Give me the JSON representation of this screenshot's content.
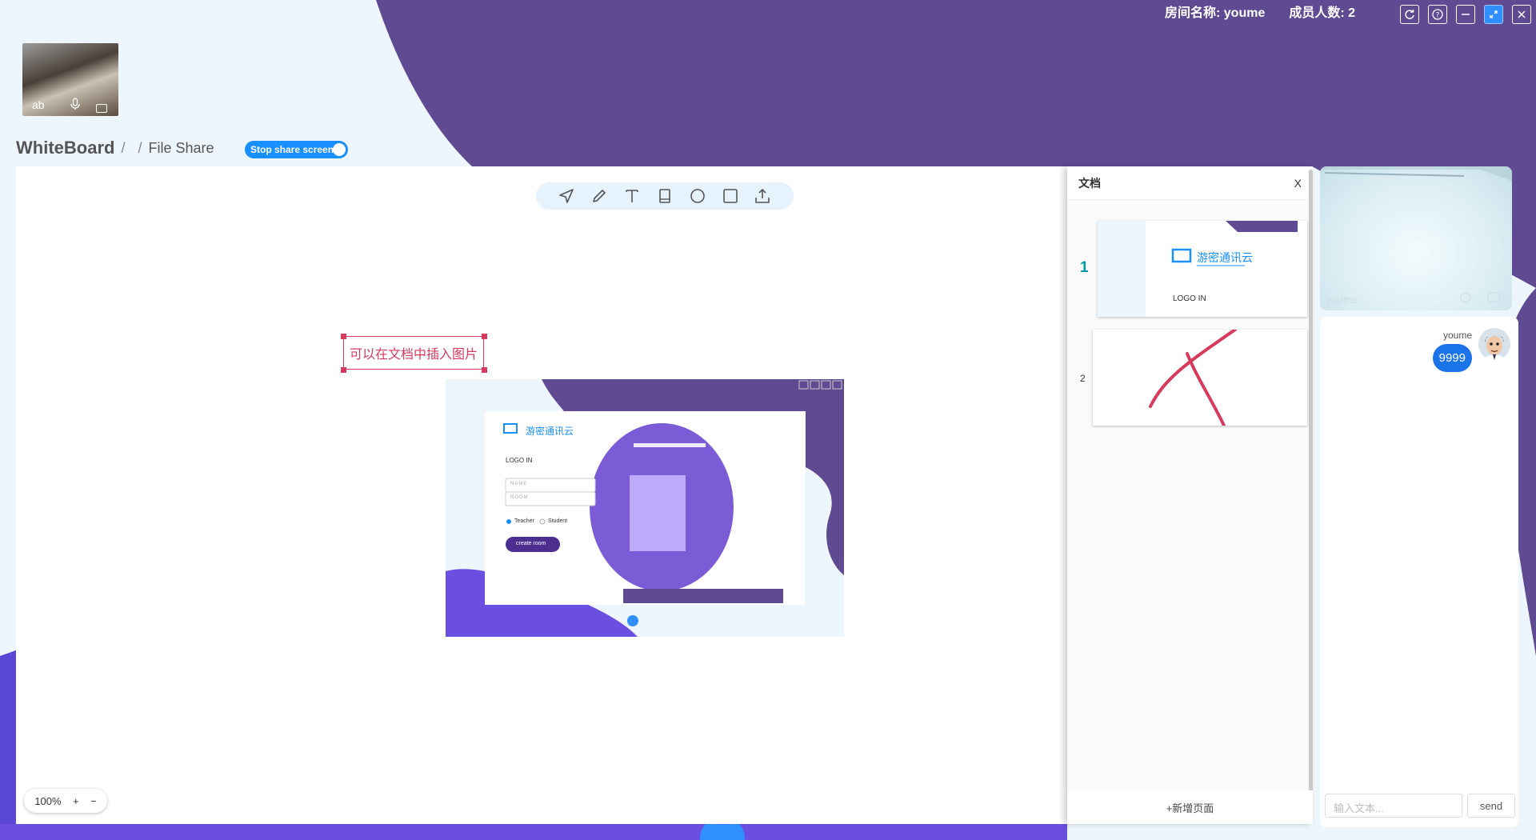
{
  "header": {
    "room_name": "房间名称: youme",
    "member_count": "成员人数: 2",
    "controls": [
      "refresh-icon",
      "help-icon",
      "minimize-icon",
      "restore-icon",
      "close-icon"
    ]
  },
  "self_video": {
    "name": "ab",
    "mic_icon": "microphone-icon",
    "cam_icon": "camera-icon"
  },
  "breadcrumb": {
    "root": "WhiteBoard",
    "sep1": "/",
    "sep2": "/",
    "current": "File Share"
  },
  "share_toggle": {
    "label": "Stop share screen",
    "on": true
  },
  "toolbar": {
    "tools": [
      "pointer-icon",
      "pencil-icon",
      "text-icon",
      "book-icon",
      "circle-icon",
      "rectangle-icon",
      "upload-icon"
    ]
  },
  "canvas": {
    "text_annotation": "可以在文档中插入图片",
    "embedded_image": {
      "logo_text": "游密通讯云",
      "login_title": "LOGO IN",
      "name_placeholder": "NAME",
      "room_placeholder": "ROOM",
      "role_teacher": "Teacher",
      "role_student": "Student",
      "create_button": "create room"
    },
    "zoom": {
      "level": "100%",
      "plus": "+",
      "minus": "−"
    }
  },
  "doc_panel": {
    "title": "文档",
    "close": "X",
    "pages": [
      {
        "number": "1",
        "active": true,
        "logo_text": "游密通讯云",
        "login_title": "LOGO IN"
      },
      {
        "number": "2",
        "active": false
      }
    ],
    "add_page": "+新增页面"
  },
  "remote_video": {
    "name": "youme"
  },
  "chat": {
    "messages": [
      {
        "user": "youme",
        "text": "9999"
      }
    ],
    "input_placeholder": "输入文本...",
    "send_label": "send"
  },
  "colors": {
    "purple": "#604a92",
    "accent_blue": "#1890ff",
    "annotation_red": "#d63b5e"
  }
}
